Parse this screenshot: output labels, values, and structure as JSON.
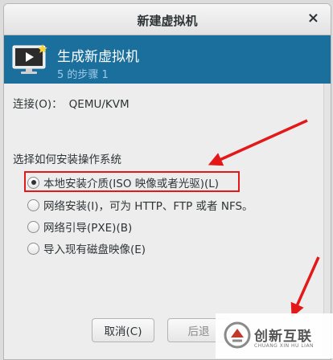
{
  "window": {
    "title": "新建虚拟机",
    "close_glyph": "×"
  },
  "header": {
    "title": "生成新虚拟机",
    "step": "5 的步骤 1",
    "icon": "monitor-play-icon"
  },
  "connection": {
    "label": "连接(O)：",
    "value": "QEMU/KVM"
  },
  "install_method": {
    "question": "选择如何安装操作系统",
    "options": [
      {
        "label": "本地安装介质(ISO 映像或者光驱)(L)",
        "selected": true
      },
      {
        "label": "网络安装(I)，可为 HTTP、FTP 或者 NFS。",
        "selected": false
      },
      {
        "label": "网络引导(PXE)(B)",
        "selected": false
      },
      {
        "label": "导入现有磁盘映像(E)",
        "selected": false
      }
    ]
  },
  "buttons": {
    "cancel": "取消(C)",
    "back": "后退"
  },
  "annotations": {
    "highlight_color": "#e31818",
    "arrow_color": "#e31818"
  },
  "watermark": {
    "main": "创新互联",
    "sub": "CHUANG XIN HU LIAN"
  }
}
